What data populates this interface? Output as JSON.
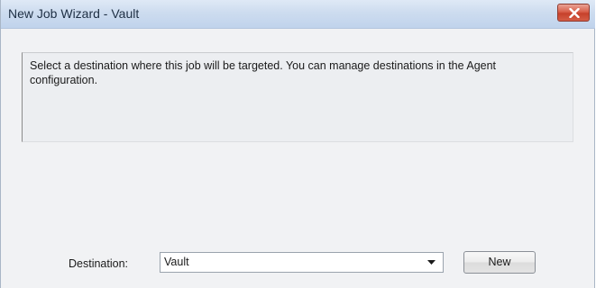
{
  "window": {
    "title": "New Job Wizard - Vault",
    "close_icon": "close-icon"
  },
  "info": {
    "text": "Select a destination where this job will be targeted. You can manage destinations in the Agent configuration."
  },
  "destination": {
    "label": "Destination:",
    "selected": "Vault",
    "arrow_icon": "chevron-down-icon",
    "new_button_label": "New"
  },
  "colors": {
    "titlebar": "#cddcef",
    "close_button": "#d2503a",
    "dialog_background": "#f1f2f4"
  }
}
